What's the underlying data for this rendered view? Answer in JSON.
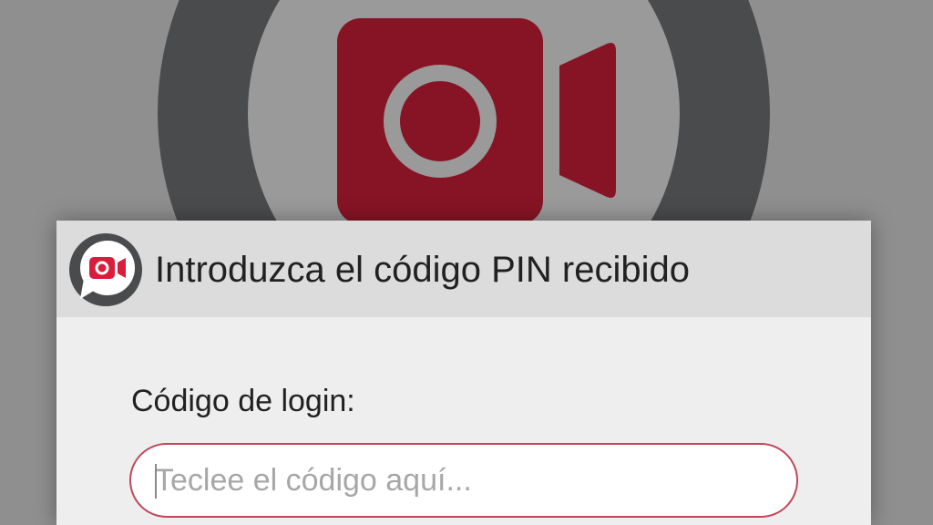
{
  "colors": {
    "brand_red": "#871424",
    "outer_ring": "#4a4b4d",
    "inner_circle": "#9a9a9a",
    "input_border": "#c0485a"
  },
  "background": {
    "logo_icon": "video-camera-icon"
  },
  "dialog": {
    "icon": "video-chat-icon",
    "title": "Introduzca el código PIN recibido",
    "field_label": "Código de login:",
    "input": {
      "value": "",
      "placeholder": "Teclee el código aquí..."
    }
  }
}
